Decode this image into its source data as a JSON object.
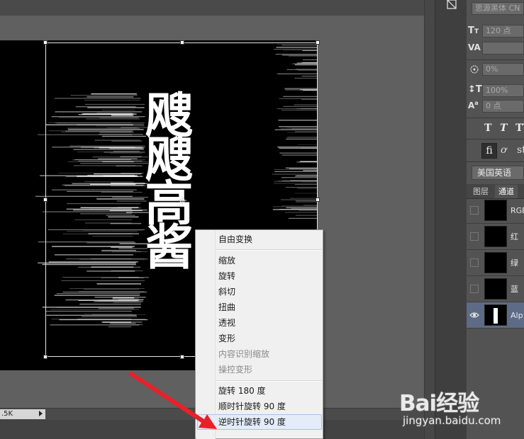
{
  "properties": {
    "font_family": "思源黑体 CN",
    "font_size": "120 点",
    "tracking_label": "VA",
    "baseline": "0%",
    "vertical_scale": "100%",
    "baseline_shift": "0 点",
    "language": "美国英语"
  },
  "tabs": [
    "图层",
    "通道"
  ],
  "channels": [
    {
      "name": "RGB",
      "selected": false
    },
    {
      "name": "红",
      "selected": false
    },
    {
      "name": "绿",
      "selected": false
    },
    {
      "name": "蓝",
      "selected": false
    },
    {
      "name": "Alp",
      "selected": true
    }
  ],
  "canvas_text": "飕飕高酱",
  "status": {
    "zoom": ".5K"
  },
  "context_menu": {
    "items": [
      {
        "label": "自由变换",
        "enabled": true
      },
      {
        "label": "缩放",
        "enabled": true
      },
      {
        "label": "旋转",
        "enabled": true
      },
      {
        "label": "斜切",
        "enabled": true
      },
      {
        "label": "扭曲",
        "enabled": true
      },
      {
        "label": "透视",
        "enabled": true
      },
      {
        "label": "变形",
        "enabled": true
      },
      {
        "label": "内容识别缩放",
        "enabled": false
      },
      {
        "label": "操控变形",
        "enabled": false
      },
      {
        "label": "旋转 180 度",
        "enabled": true
      },
      {
        "label": "顺时针旋转 90 度",
        "enabled": true
      },
      {
        "label": "逆时针旋转 90 度",
        "enabled": true,
        "highlighted": true
      }
    ]
  },
  "watermark": {
    "logo": "Bai经验",
    "url": "jingyan.baidu.com"
  },
  "colors": {
    "annotation_arrow": "#e8202a",
    "selected_channel": "#5d6b86"
  }
}
